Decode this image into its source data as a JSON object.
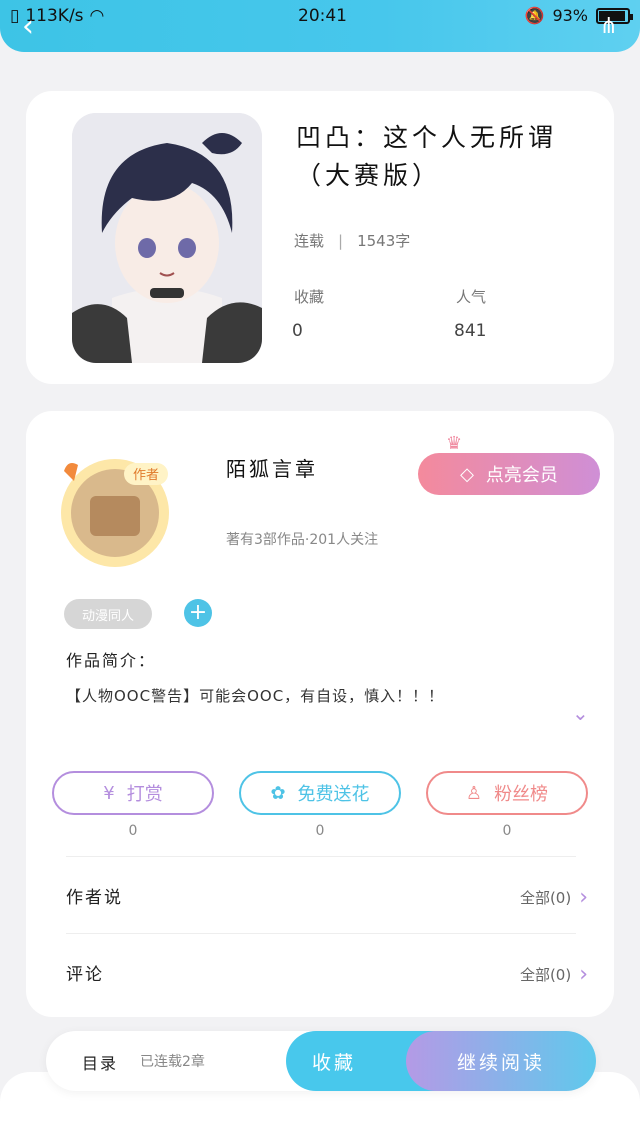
{
  "status_bar": {
    "speed": "113K/s",
    "time": "20:41",
    "battery": "93%",
    "battery_level": 0.93
  },
  "book": {
    "title": "凹凸：这个人无所谓（大赛版）",
    "status": "连载",
    "word_count": "1543字",
    "favorites_label": "收藏",
    "favorites_value": "0",
    "popularity_label": "人气",
    "popularity_value": "841"
  },
  "author": {
    "name": "陌狐言章",
    "badge": "作者",
    "meta": "著有3部作品·201人关注",
    "vip_label": "点亮会员"
  },
  "tags": [
    "动漫同人"
  ],
  "intro": {
    "label": "作品简介：",
    "text": "【人物OOC警告】可能会OOC，有自设，慎入！！！"
  },
  "actions": [
    {
      "label": "打赏",
      "count": "0",
      "color": "#b48ede"
    },
    {
      "label": "免费送花",
      "count": "0",
      "color": "#4ec3e6"
    },
    {
      "label": "粉丝榜",
      "count": "0",
      "color": "#f08a8a"
    }
  ],
  "rows": [
    {
      "title": "作者说",
      "link": "全部(0)"
    },
    {
      "title": "评论",
      "link": "全部(0)"
    }
  ],
  "bottom": {
    "toc_label": "目录",
    "toc_status": "已连载2章",
    "favorite_label": "收藏",
    "read_label": "继续阅读"
  }
}
